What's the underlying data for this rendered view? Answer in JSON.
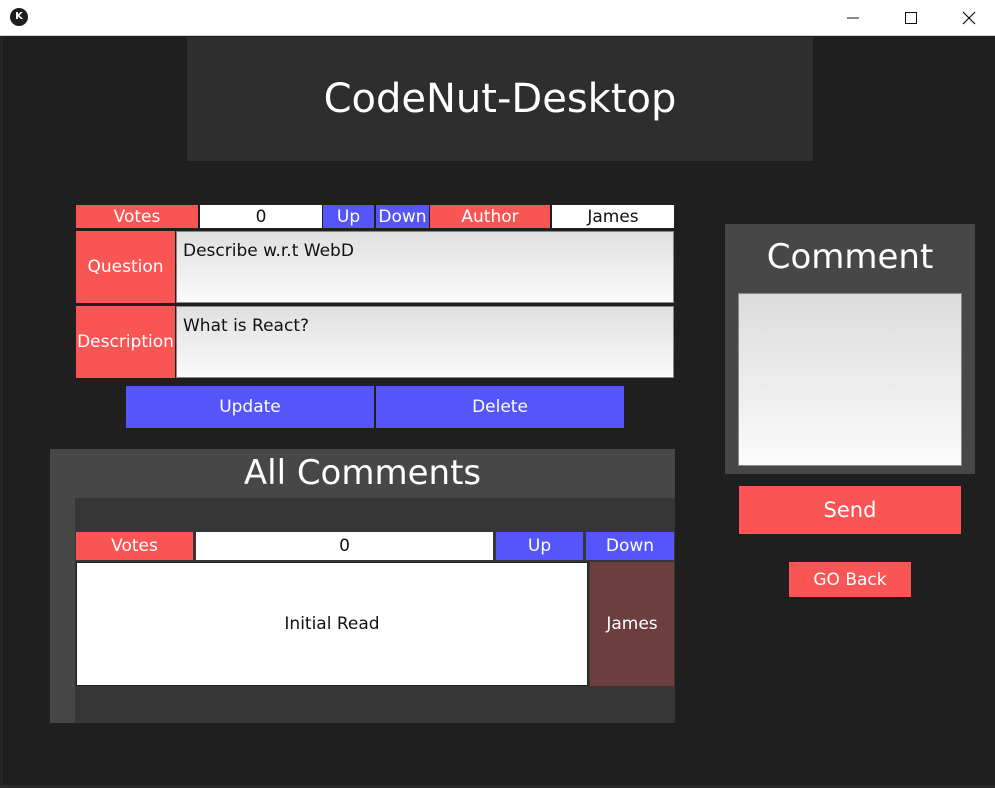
{
  "window": {
    "logo_glyph": "K",
    "controls": {
      "minimize_icon": "minimize-icon",
      "maximize_icon": "maximize-icon",
      "close_icon": "close-icon"
    }
  },
  "header": {
    "title": "CodeNut-Desktop"
  },
  "question": {
    "votes_label": "Votes",
    "votes_value": "0",
    "up_label": "Up",
    "down_label": "Down",
    "author_label": "Author",
    "author_value": "James",
    "question_label": "Question",
    "question_value": "Describe w.r.t WebD",
    "description_label": "Description",
    "description_value": "What is React?",
    "update_label": "Update",
    "delete_label": "Delete"
  },
  "all_comments": {
    "title": "All Comments",
    "items": [
      {
        "votes_label": "Votes",
        "votes_value": "0",
        "up_label": "Up",
        "down_label": "Down",
        "text": "Initial Read",
        "author": "James"
      }
    ]
  },
  "comment_box": {
    "title": "Comment",
    "input_value": "",
    "send_label": "Send",
    "go_back_label": "GO Back"
  },
  "colors": {
    "accent_red": "#fa5555",
    "accent_blue": "#5555fa",
    "author_bg": "#6d3e3e",
    "panel_bg": "#474747",
    "window_bg": "#1f1f1f"
  }
}
